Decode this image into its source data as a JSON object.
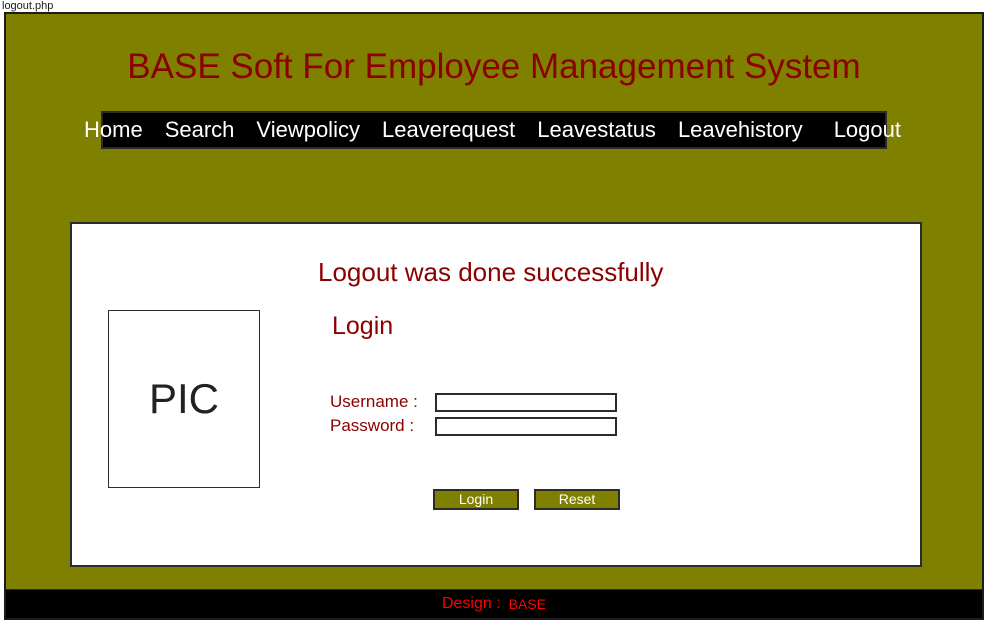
{
  "window": {
    "page_title": "logout.php"
  },
  "header": {
    "site_title": "BASE Soft For Employee Management System"
  },
  "nav": {
    "items": [
      {
        "label": "Home"
      },
      {
        "label": "Search"
      },
      {
        "label": "Viewpolicy"
      },
      {
        "label": "Leaverequest"
      },
      {
        "label": "Leavestatus"
      },
      {
        "label": "Leavehistory"
      },
      {
        "label": "Logout"
      }
    ]
  },
  "main": {
    "status_message": "Logout was done successfully",
    "login_heading": "Login",
    "pic_placeholder": "PIC",
    "form": {
      "username_label": "Username :",
      "username_value": "",
      "username_placeholder": "",
      "password_label": "Password :",
      "password_value": "",
      "password_placeholder": "",
      "login_button": "Login",
      "reset_button": "Reset"
    }
  },
  "footer": {
    "design_label": "Design :",
    "brand": "BASE"
  },
  "colors": {
    "page_background": "#808000",
    "title_text": "#8b0000",
    "nav_background": "#000000",
    "nav_text": "#ffffff",
    "panel_background": "#ffffff",
    "border": "#2b2b2b",
    "footer_background": "#000000",
    "footer_text": "#ff0000",
    "button_background": "#808000"
  }
}
